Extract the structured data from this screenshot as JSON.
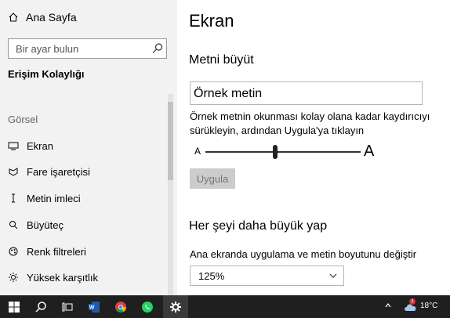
{
  "sidebar": {
    "home_label": "Ana Sayfa",
    "search_placeholder": "Bir ayar bulun",
    "category": "Erişim Kolaylığı",
    "group_label": "Görsel",
    "items": [
      {
        "label": "Ekran",
        "icon": "display-icon"
      },
      {
        "label": "Fare işaretçisi",
        "icon": "mouse-pointer-icon"
      },
      {
        "label": "Metin imleci",
        "icon": "text-cursor-icon"
      },
      {
        "label": "Büyüteç",
        "icon": "magnifier-icon"
      },
      {
        "label": "Renk filtreleri",
        "icon": "color-filter-icon"
      },
      {
        "label": "Yüksek karşıtlık",
        "icon": "high-contrast-icon"
      }
    ]
  },
  "main": {
    "title": "Ekran",
    "section1_heading": "Metni büyüt",
    "sample_text": "Örnek metin",
    "description": "Örnek metnin okunması kolay olana kadar kaydırıcıyı sürükleyin, ardından Uygula'ya tıklayın",
    "slider_min_label": "A",
    "slider_max_label": "A",
    "slider_value_fraction": 0.45,
    "apply_label": "Uygula",
    "section2_heading": "Her şeyi daha büyük yap",
    "scale_description": "Ana ekranda uygulama ve metin boyutunu değiştir",
    "scale_value": "125%"
  },
  "taskbar": {
    "temperature": "18°C",
    "notification_count": "1",
    "apps": [
      "windows-start-icon",
      "search-icon",
      "task-view-icon",
      "word-icon",
      "chrome-icon",
      "whatsapp-icon",
      "settings-icon"
    ]
  },
  "colors": {
    "sidebar_bg": "#f2f2f2",
    "taskbar_bg": "#1f1f1f",
    "disabled_button": "#cccccc",
    "accent": "#0078d7"
  }
}
